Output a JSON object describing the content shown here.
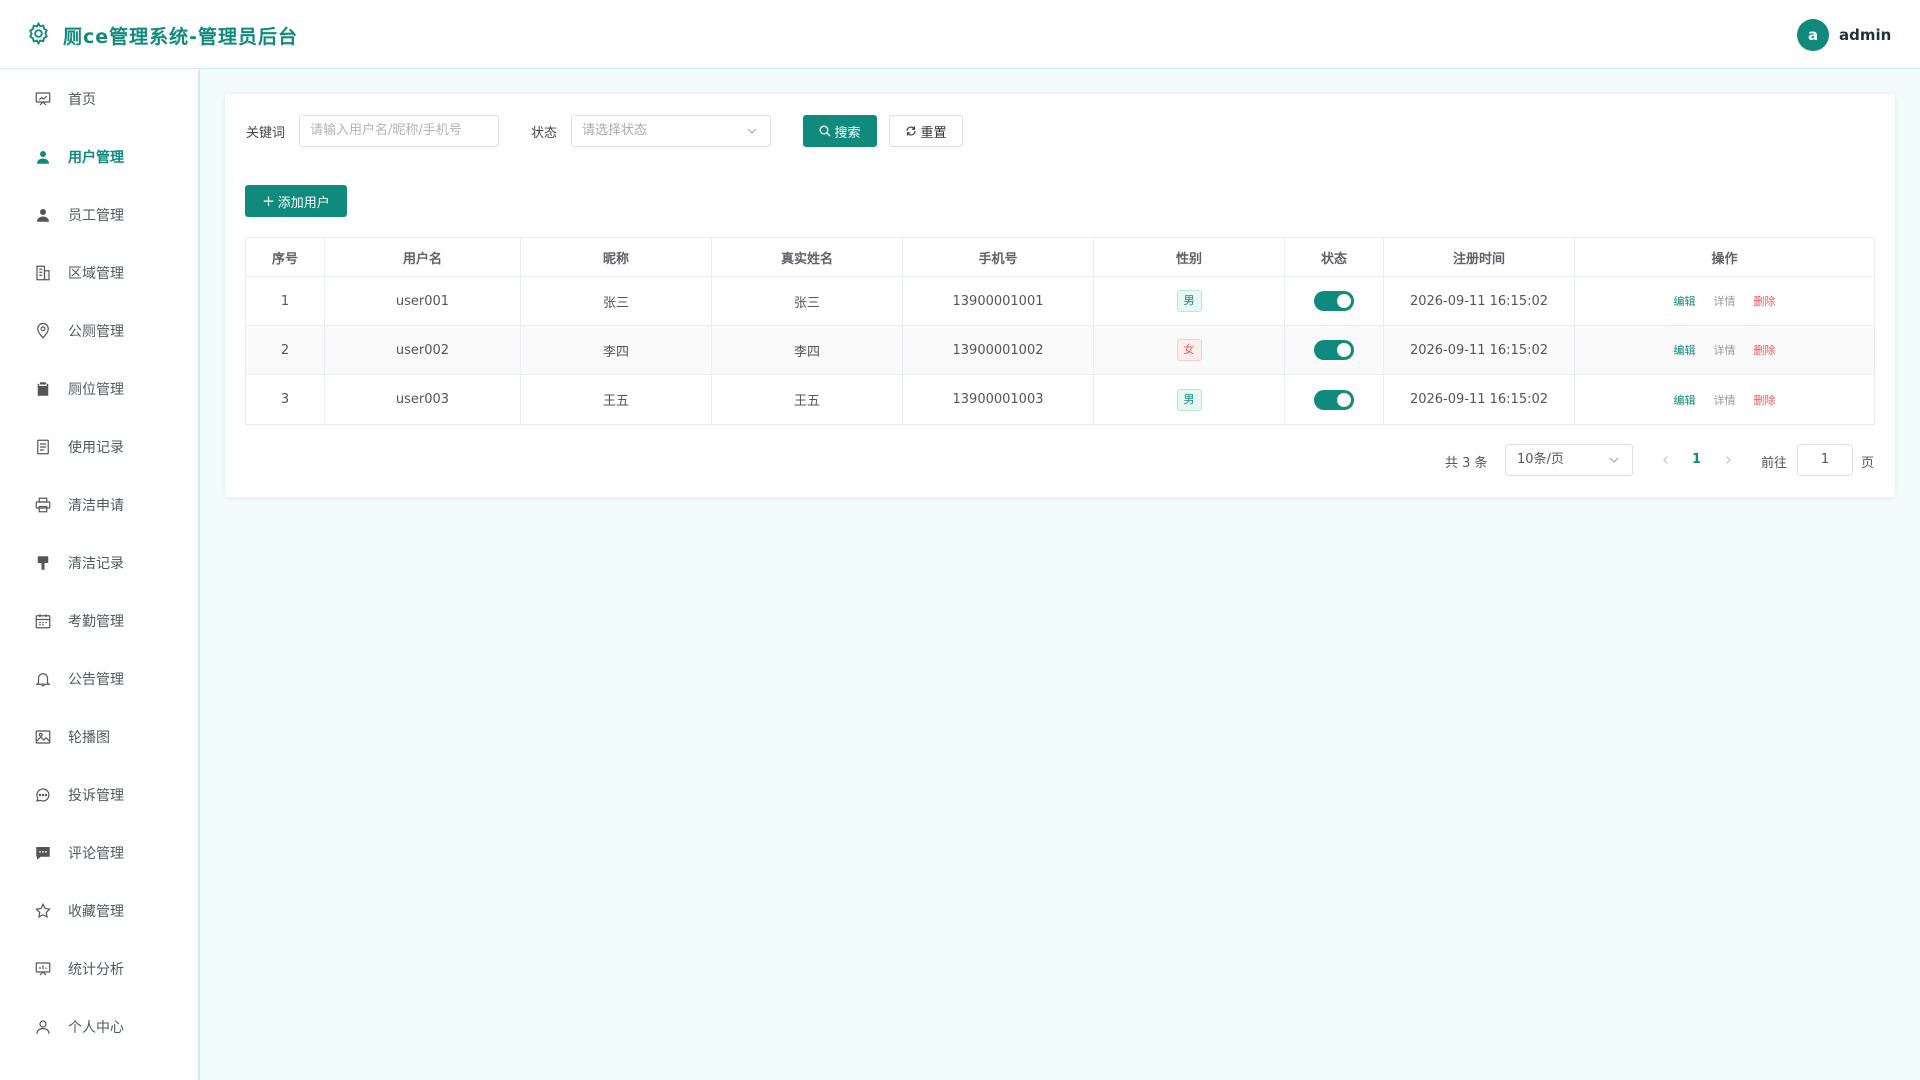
{
  "header": {
    "title": "厕ce管理系统-管理员后台",
    "avatar_letter": "a",
    "username": "admin",
    "brand_color": "#108a7c"
  },
  "sidebar": {
    "items": [
      {
        "label": "首页",
        "icon": "dashboard-icon"
      },
      {
        "label": "用户管理",
        "icon": "user-icon",
        "active": true
      },
      {
        "label": "员工管理",
        "icon": "employee-icon"
      },
      {
        "label": "区域管理",
        "icon": "building-icon"
      },
      {
        "label": "公厕管理",
        "icon": "location-icon"
      },
      {
        "label": "厕位管理",
        "icon": "clipboard-icon"
      },
      {
        "label": "使用记录",
        "icon": "document-icon"
      },
      {
        "label": "清洁申请",
        "icon": "printer-icon"
      },
      {
        "label": "清洁记录",
        "icon": "brush-icon"
      },
      {
        "label": "考勤管理",
        "icon": "calendar-icon"
      },
      {
        "label": "公告管理",
        "icon": "bell-icon"
      },
      {
        "label": "轮播图",
        "icon": "picture-icon"
      },
      {
        "label": "投诉管理",
        "icon": "chat-bubble-icon"
      },
      {
        "label": "评论管理",
        "icon": "comment-icon"
      },
      {
        "label": "收藏管理",
        "icon": "star-icon"
      },
      {
        "label": "统计分析",
        "icon": "chart-board-icon"
      },
      {
        "label": "个人中心",
        "icon": "person-outline-icon"
      }
    ]
  },
  "filters": {
    "keyword_label": "关键词",
    "keyword_placeholder": "请输入用户名/昵称/手机号",
    "status_label": "状态",
    "status_placeholder": "请选择状态",
    "search_label": "搜索",
    "reset_label": "重置"
  },
  "actions": {
    "add_label": "添加用户"
  },
  "table": {
    "columns": [
      "序号",
      "用户名",
      "昵称",
      "真实姓名",
      "手机号",
      "性别",
      "状态",
      "注册时间",
      "操作"
    ],
    "rows": [
      {
        "index": "1",
        "username": "user001",
        "nickname": "张三",
        "realname": "张三",
        "phone": "13900001001",
        "gender": "男",
        "gender_type": "male",
        "enabled": true,
        "registered": "2026-09-11 16:15:02"
      },
      {
        "index": "2",
        "username": "user002",
        "nickname": "李四",
        "realname": "李四",
        "phone": "13900001002",
        "gender": "女",
        "gender_type": "female",
        "enabled": true,
        "registered": "2026-09-11 16:15:02"
      },
      {
        "index": "3",
        "username": "user003",
        "nickname": "王五",
        "realname": "王五",
        "phone": "13900001003",
        "gender": "男",
        "gender_type": "male",
        "enabled": true,
        "registered": "2026-09-11 16:15:02"
      }
    ],
    "ops": {
      "edit": "编辑",
      "detail": "详情",
      "delete": "删除"
    }
  },
  "pagination": {
    "total_text": "共 3 条",
    "page_size": "10条/页",
    "current_page": "1",
    "goto_label": "前往",
    "goto_value": "1",
    "page_suffix": "页"
  }
}
